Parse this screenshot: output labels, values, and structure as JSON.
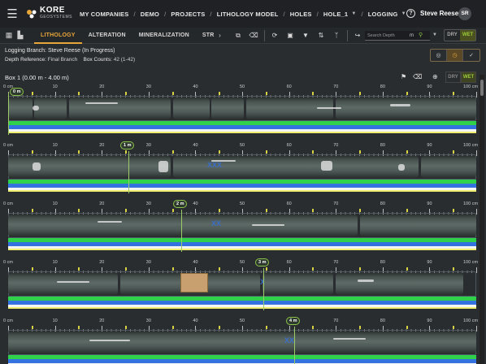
{
  "header": {
    "logo_name": "KORE",
    "logo_sub": "GEOSYSTEMS",
    "breadcrumbs": [
      "MY COMPANIES",
      "DEMO",
      "PROJECTS",
      "LITHOLOGY MODEL",
      "HOLES",
      "HOLE_1",
      "LOGGING"
    ],
    "user_name": "Steve Reese",
    "user_initials": "SR"
  },
  "toolbar": {
    "tabs": [
      "LITHOLOGY",
      "ALTERATION",
      "MINERALIZATION",
      "STR"
    ],
    "active_tab": "LITHOLOGY",
    "search_placeholder": "Search Depth",
    "search_unit": "m",
    "dry_label": "DRY",
    "wet_label": "WET",
    "active_mode": "WET"
  },
  "info": {
    "branch_label": "Logging Branch:",
    "branch_value": "Steve Reese  (In Progress)",
    "depth_ref_label": "Depth Reference:",
    "depth_ref_value": "Final Branch",
    "box_counts_label": "Box Counts:",
    "box_counts_value": "42 (1-42)"
  },
  "box": {
    "title": "Box 1 (0.00 m - 4.00 m)",
    "dry_label": "DRY",
    "wet_label": "WET"
  },
  "ruler_labels": [
    "0 cm",
    "10",
    "20",
    "30",
    "40",
    "50",
    "60",
    "70",
    "80",
    "90",
    "100 cm"
  ],
  "rows": [
    {
      "depth_marker": "0 m"
    },
    {
      "depth_marker": "1 m"
    },
    {
      "depth_marker": "2 m"
    },
    {
      "depth_marker": "3 m"
    },
    {
      "depth_marker": "4 m"
    }
  ],
  "colors": {
    "accent": "#e8a63a",
    "wet_green": "#9ccc3c",
    "band_green": "#2fd14a",
    "band_blue": "#3472e0"
  }
}
